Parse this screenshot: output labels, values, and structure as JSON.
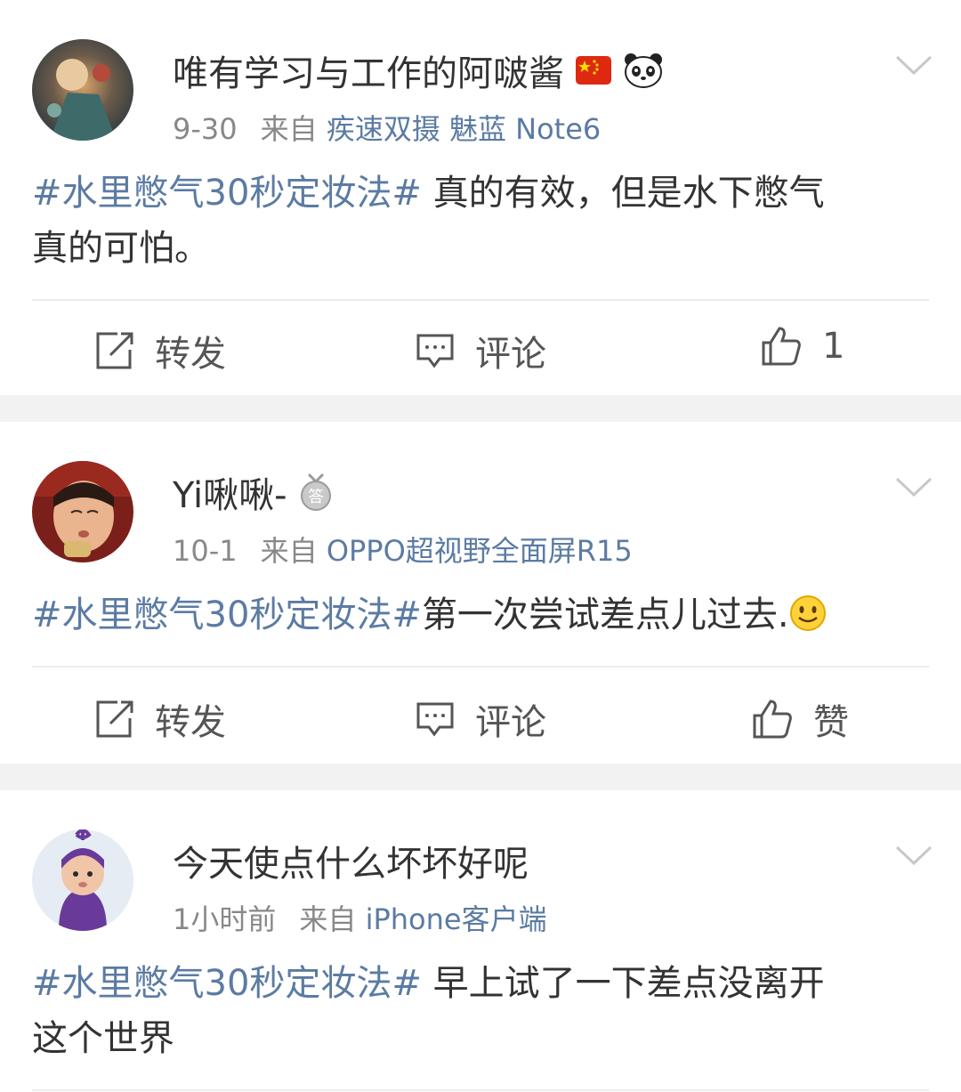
{
  "posts": [
    {
      "username": "唯有学习与工作的阿啵酱",
      "badges": [
        "flag-cn-icon",
        "panda-icon"
      ],
      "time": "9-30",
      "from_label": "来自",
      "source": "疾速双摄 魅蓝 Note6",
      "hashtag": "#水里憋气30秒定妆法#",
      "text_line1": " 真的有效，但是水下憋气",
      "text_line2": "真的可怕。",
      "actions": {
        "repost": "转发",
        "comment": "评论",
        "like": "1"
      }
    },
    {
      "username": "Yi啾啾-",
      "badges": [
        "medal-answer-icon"
      ],
      "badge_text": "答",
      "time": "10-1",
      "from_label": "来自",
      "source": "OPPO超视野全面屏R15",
      "hashtag": "#水里憋气30秒定妆法#",
      "text_line1": "第一次尝试差点儿过去.",
      "emoji": "smile-emoji-icon",
      "actions": {
        "repost": "转发",
        "comment": "评论",
        "like": "赞"
      }
    },
    {
      "username": "今天使点什么坏坏好呢",
      "time": "1小时前",
      "from_label": "来自",
      "source": "iPhone客户端",
      "hashtag": "#水里憋气30秒定妆法#",
      "text_line1": " 早上试了一下差点没离开",
      "text_line2": "这个世界"
    }
  ],
  "colors": {
    "link": "#5b7ba3",
    "text": "#333333",
    "meta": "#888888",
    "divider": "#f2f2f2"
  }
}
